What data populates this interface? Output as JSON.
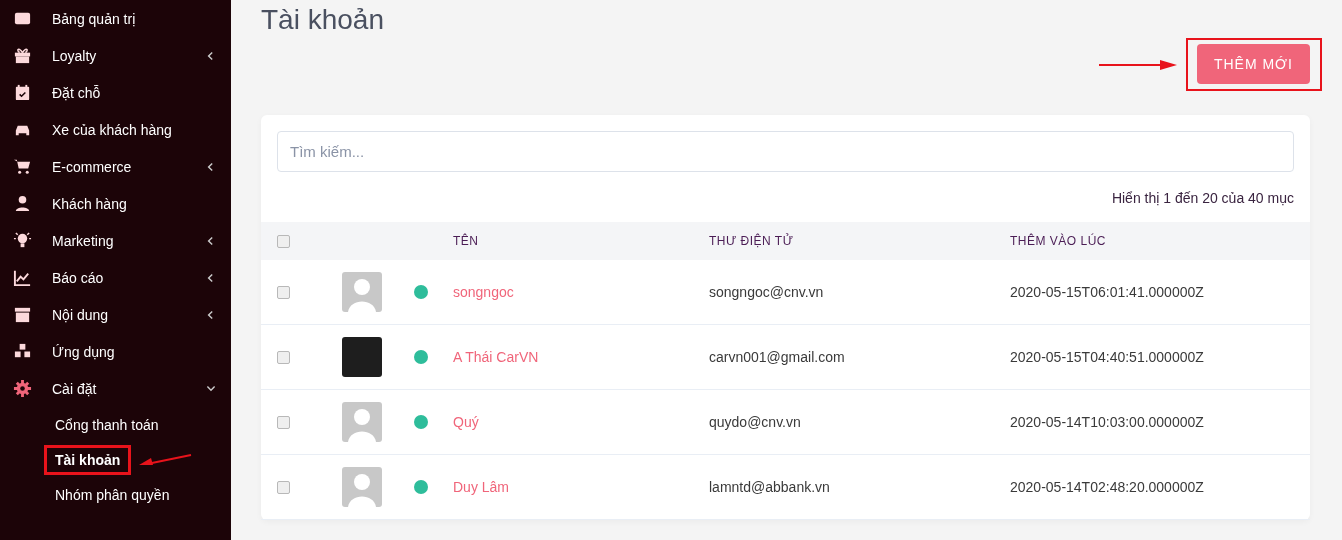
{
  "sidebar": {
    "items": [
      {
        "label": "Bảng quản trị"
      },
      {
        "label": "Loyalty",
        "expanded": false
      },
      {
        "label": "Đặt chỗ"
      },
      {
        "label": "Xe của khách hàng"
      },
      {
        "label": "E-commerce",
        "expanded": false
      },
      {
        "label": "Khách hàng"
      },
      {
        "label": "Marketing",
        "expanded": false
      },
      {
        "label": "Báo cáo",
        "expanded": false
      },
      {
        "label": "Nội dung",
        "expanded": false
      },
      {
        "label": "Ứng dụng"
      },
      {
        "label": "Cài đặt",
        "expanded": true,
        "children": [
          {
            "label": "Cổng thanh toán",
            "selected": false,
            "annotated": false
          },
          {
            "label": "Tài khoản",
            "selected": true,
            "annotated": true
          },
          {
            "label": "Nhóm phân quyền",
            "selected": false,
            "annotated": false
          }
        ]
      }
    ]
  },
  "page": {
    "title": "Tài khoản",
    "add_button": {
      "label": "THÊM MỚI",
      "annotated": true
    }
  },
  "search": {
    "placeholder": "Tìm kiếm..."
  },
  "summary": "Hiển thị 1 đến 20 của 40 mục",
  "table": {
    "columns": [
      "TÊN",
      "THƯ ĐIỆN TỬ",
      "THÊM VÀO LÚC"
    ],
    "all_checked": false,
    "rows": [
      {
        "checked": false,
        "kind": "placeholder",
        "color": "#2ebd9b",
        "name": "songngoc",
        "email": "songngoc@cnv.vn",
        "added": "2020-05-15T06:01:41.000000Z"
      },
      {
        "checked": false,
        "kind": "logo",
        "color": "#2ebd9b",
        "name": "A Thái CarVN",
        "email": "carvn001@gmail.com",
        "added": "2020-05-15T04:40:51.000000Z"
      },
      {
        "checked": false,
        "kind": "placeholder",
        "color": "#2ebd9b",
        "name": "Quý",
        "email": "quydo@cnv.vn",
        "added": "2020-05-14T10:03:00.000000Z"
      },
      {
        "checked": false,
        "kind": "placeholder",
        "color": "#2ebd9b",
        "name": "Duy Lâm",
        "email": "lamntd@abbank.vn",
        "added": "2020-05-14T02:48:20.000000Z"
      }
    ]
  }
}
